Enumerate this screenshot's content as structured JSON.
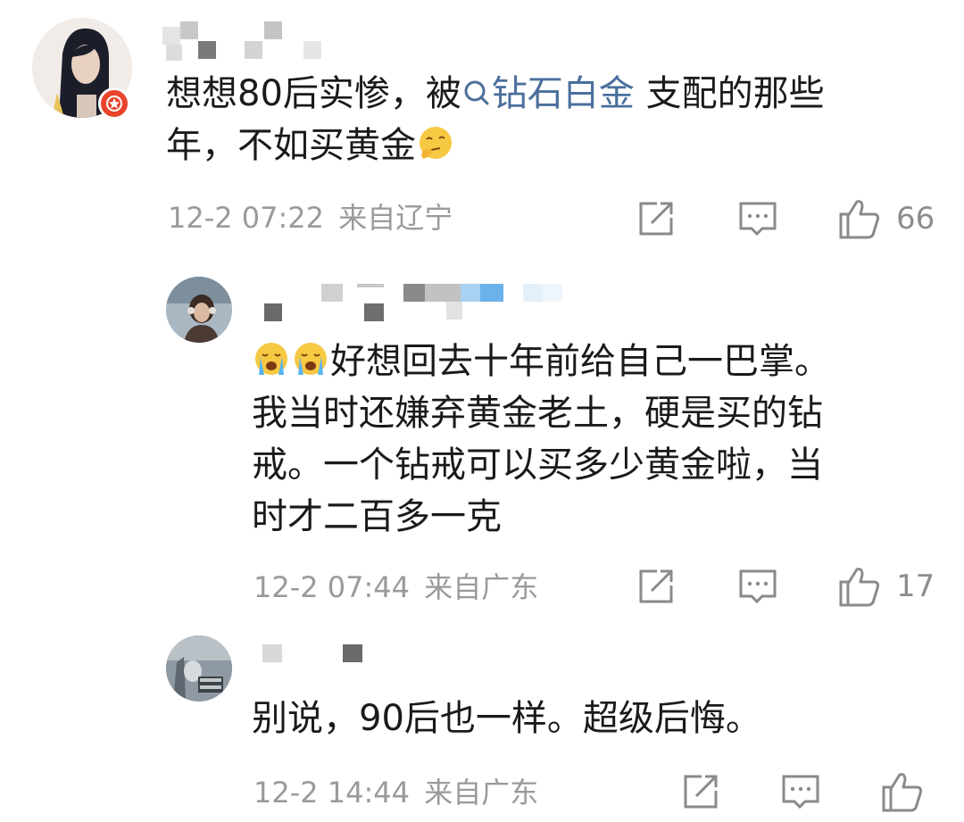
{
  "comments": [
    {
      "line1_pre": "想想80后实惨，被",
      "topic": "钻石白金",
      "line1_post": "支配的那些",
      "line2": "年，不如买黄金",
      "timestamp": "12-2 07:22",
      "location": "来自辽宁",
      "like_count": "66"
    },
    {
      "line1": "好想回去十年前给自己一巴掌。",
      "line2": "我当时还嫌弃黄金老土，硬是买的钻",
      "line3": "戒。一个钻戒可以买多少黄金啦，当",
      "line4": "时才二百多一克",
      "timestamp": "12-2 07:44",
      "location": "来自广东",
      "like_count": "17"
    },
    {
      "line1": "别说，90后也一样。超级后悔。",
      "timestamp": "12-2 14:44",
      "location": "来自广东"
    }
  ],
  "icons": {
    "share": "share-icon",
    "comment": "comment-icon",
    "like": "thumbs-up-icon",
    "search": "search-icon"
  },
  "colors": {
    "topic_link": "#4a6f9c",
    "meta_gray": "#9a9a9a",
    "badge_red": "#e8452c"
  }
}
